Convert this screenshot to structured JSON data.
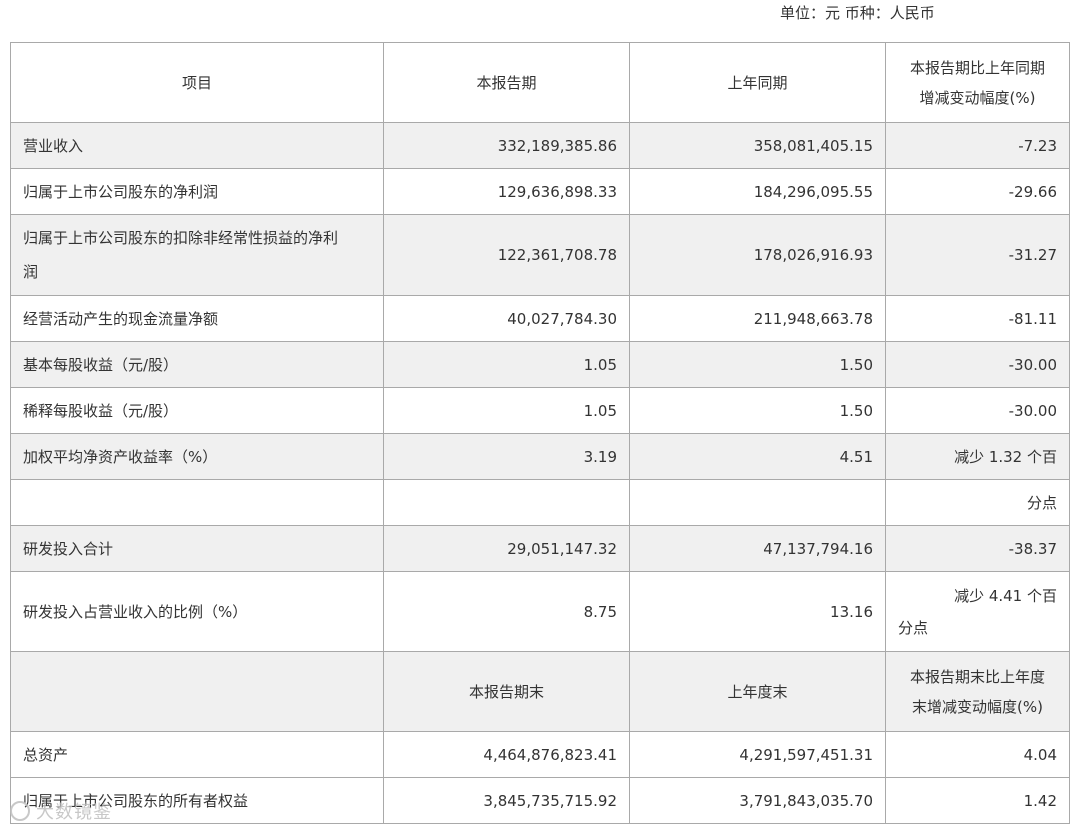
{
  "unit_line": "单位：元 币种：人民币",
  "header1": {
    "item": "项目",
    "current": "本报告期",
    "prior": "上年同期",
    "change_line1": "本报告期比上年同期",
    "change_line2": "增减变动幅度(%)"
  },
  "rows": [
    {
      "label": "营业收入",
      "current": "332,189,385.86",
      "prior": "358,081,405.15",
      "change": "-7.23"
    },
    {
      "label": "归属于上市公司股东的净利润",
      "current": "129,636,898.33",
      "prior": "184,296,095.55",
      "change": "-29.66"
    },
    {
      "label_line1": "归属于上市公司股东的扣除非经常性损益的净利",
      "label_line2": "润",
      "current": "122,361,708.78",
      "prior": "178,026,916.93",
      "change": "-31.27"
    },
    {
      "label": "经营活动产生的现金流量净额",
      "current": "40,027,784.30",
      "prior": "211,948,663.78",
      "change": "-81.11"
    },
    {
      "label": "基本每股收益（元/股）",
      "current": "1.05",
      "prior": "1.50",
      "change": "-30.00"
    },
    {
      "label": "稀释每股收益（元/股）",
      "current": "1.05",
      "prior": "1.50",
      "change": "-30.00"
    },
    {
      "label": "加权平均净资产收益率（%）",
      "current": "3.19",
      "prior": "4.51",
      "change": "减少 1.32 个百",
      "change_cont": "分点"
    },
    {
      "label": "研发投入合计",
      "current": "29,051,147.32",
      "prior": "47,137,794.16",
      "change": "-38.37"
    },
    {
      "label": "研发投入占营业收入的比例（%）",
      "current": "8.75",
      "prior": "13.16",
      "change_line1": "减少 4.41 个百",
      "change_line2": "分点"
    }
  ],
  "header2": {
    "item": "",
    "current": "本报告期末",
    "prior": "上年度末",
    "change_line1": "本报告期末比上年度",
    "change_line2": "末增减变动幅度(%)"
  },
  "rows2": [
    {
      "label": "总资产",
      "current": "4,464,876,823.41",
      "prior": "4,291,597,451.31",
      "change": "4.04"
    },
    {
      "label": "归属于上市公司股东的所有者权益",
      "current": "3,845,735,715.92",
      "prior": "3,791,843,035.70",
      "change": "1.42"
    }
  ],
  "watermark": "大数镜鉴"
}
